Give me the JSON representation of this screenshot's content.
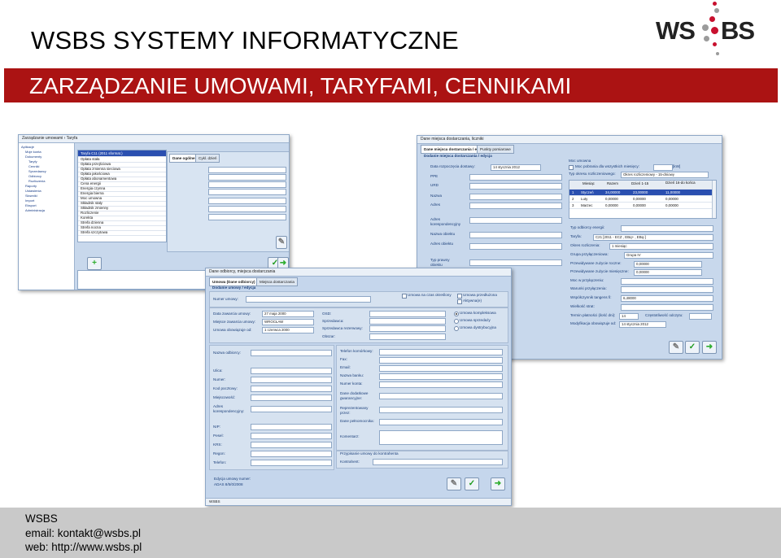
{
  "slide": {
    "title": "WSBS SYSTEMY INFORMATYCZNE",
    "subtitle": "ZARZĄDZANIE UMOWAMI, TARYFAMI, CENNIKAMI",
    "band_color": "#ab1313",
    "logo": {
      "left": "WS",
      "right": "BS",
      "dot_colors": [
        "#c8102e",
        "#9b9b9b"
      ]
    }
  },
  "footer": {
    "company": "WSBS",
    "email": "email: kontakt@wsbs.pl",
    "web": "web: http://www.wsbs.pl"
  },
  "left_window": {
    "title": "Zarządzanie umowami › Taryfa",
    "tree": [
      "Aplikacje",
      "Moje konta",
      "Dokumenty",
      "Taryfy",
      "Cenniki",
      "Sprzedawcy",
      "Odbiorcy",
      "Rozliczenia",
      "Raporty",
      "Ustawienia",
      "Słowniki",
      "Import",
      "Eksport",
      "Administracja"
    ],
    "list_title": "Taryfa C11 (2011 sformat.)",
    "list_items": [
      "Opłata stała",
      "Opłata przejściowa",
      "Opłata zmienna sieciowa",
      "Opłata jakościowa",
      "Opłata abonamentowa",
      "Cena energii",
      "Energia czynna",
      "Energia bierna",
      "Moc umowna",
      "Składnik stały",
      "Składnik zmienny",
      "Rozliczenie",
      "Korekta",
      "Strefa dzienna",
      "Strefa nocna",
      "Strefa szczytowa"
    ],
    "tab_active": "Dane ogólne",
    "tab_other": "Cykl. dzień"
  },
  "right_window": {
    "title": "Dane miejsca dostarczania, liczniki",
    "tabs": [
      "Dane miejsca dostarczania / edycja",
      "Punkty pomiarowe"
    ],
    "section": "Dodanie miejsca dostarczania / edycja",
    "start_date_label": "Data rozpoczęcia dostawy:",
    "start_date": "14 stycznia 2012",
    "fields": [
      "PPE",
      "URD",
      "Nazwa",
      "Adres",
      "Adres korespondencyjny",
      "Nazwa obiektu",
      "Adres obiektu",
      "Typ prawny obiektu"
    ],
    "moc_label": "Moc umowna",
    "moc_row": "Moc pobrania  dla wszystkich miesięcy:",
    "okres_label": "Typ okresu rozliczeniowego:",
    "okres_value": "Okres rozliczeniowy - 15-dniowy",
    "moc_table_headers": [
      "Miesiąc",
      "Razem",
      "Dzień 1-15",
      "Dzień 16-do końca"
    ],
    "moc_table_rows": [
      [
        "1",
        "Styczeń",
        "34,00000",
        "23,00000",
        "11,00000"
      ],
      [
        "2",
        "Luty",
        "0,00000",
        "0,00000",
        "0,00000"
      ],
      [
        "3",
        "Marzec",
        "0,00000",
        "0,00000",
        "0,00000"
      ]
    ],
    "tariff_fields": [
      {
        "label": "Typ odbiorcy energii:",
        "value": ""
      },
      {
        "label": "Taryfa:",
        "value": "C21 [2011 - ECZ , EBq+ , EBq-]"
      },
      {
        "label": "Okres rozliczenia:",
        "value": "1 miesiąc"
      },
      {
        "label": "Grupa przyłączeniowa:",
        "value": "Grupa IV"
      },
      {
        "label": "Przewidywane zużycie roczne:",
        "value": "0,00000"
      },
      {
        "label": "Przewidywane zużycie miesięczne:",
        "value": "0,00000"
      },
      {
        "label": "Moc w przyłączeniu:",
        "value": ""
      },
      {
        "label": "Warunki przyłączenia:",
        "value": ""
      },
      {
        "label": "Współczynnik tangens fi:",
        "value": "6,48000"
      },
      {
        "label": "Wielkość strat:",
        "value": ""
      },
      {
        "label": "Termin płatności (ilość dni):",
        "value": "14"
      },
      {
        "label": "Modyfikacja obowiązuje od:",
        "value": "14  stycznia  2012"
      }
    ],
    "czestotliwosc_label": "Częstotliwość odczytu:",
    "unit": "[kW]"
  },
  "front_window": {
    "title": "Dane odbiorcy, miejsca dostarczania",
    "tabs": [
      "Umowa (Dane odbiorcy)",
      "Miejsca dostarczania"
    ],
    "section": "Dodanie umowy / edycja",
    "numer_label": "Numer umowy:",
    "numer_value": "",
    "check_labels": [
      "Umowa na czas określony",
      "Umowa przedłużona",
      "Aktywna(e)"
    ],
    "data_label": "Data zawarcia umowy:",
    "data_value": "27  maja  2000",
    "miejsce_label": "Miejsce zawarcia umowy:",
    "miejsce_value": "WROCŁAW",
    "od_label": "Umowa obowiązuje od:",
    "od_value": "1  czerwca  2000",
    "osd_labels": [
      "OSD:",
      "Sprzedawca:",
      "Sprzedawca rezerwowy:",
      "Obszar:"
    ],
    "radio_labels": [
      "Umowa kompleksowa",
      "Umowa sprzedaży",
      "Umowa dystrybucyjna"
    ],
    "left_fields": [
      "Nazwa odbiorcy:",
      "Ulica:",
      "Numer:",
      "Kod pocztowy:",
      "Miejscowość:",
      "Adres korespondencyjny:",
      "NIP:",
      "Pesel:",
      "KRS:",
      "Regon:",
      "Telefon:"
    ],
    "right_fields": [
      "Telefon komórkowy:",
      "Fax:",
      "Email:",
      "Nazwa banku:",
      "Numer konta:",
      "Dane dodatkowe gwarancyjne:",
      "Reprezentowany przez:",
      "Dane pełnomocnika:",
      "Komentarz:"
    ],
    "kontrahent_section": "Przypisanie umowy do kontrahenta",
    "kontrahent_label": "Kontrahent:",
    "edycja_label": "Edycja umowy numer:",
    "edycja_value": "ADAS 8/5/0/2008",
    "status": "WSBS"
  }
}
